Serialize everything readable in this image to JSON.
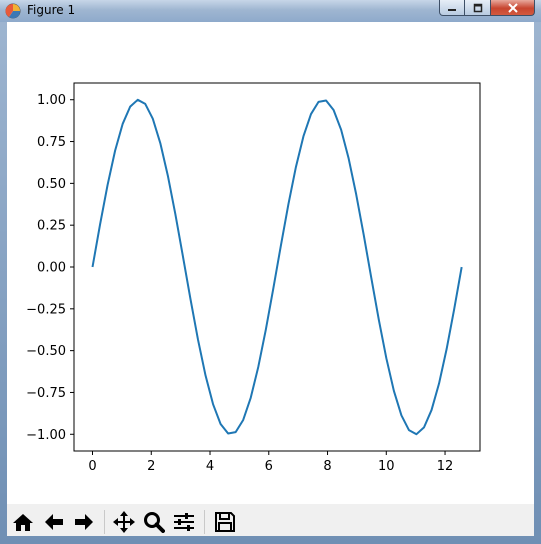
{
  "window": {
    "title": "Figure 1",
    "icons": [
      "app-icon",
      "minimize-icon",
      "maximize-icon",
      "close-icon"
    ]
  },
  "chart_data": {
    "type": "line",
    "title": "",
    "xlabel": "",
    "ylabel": "",
    "xlim": [
      -0.63,
      13.19
    ],
    "ylim": [
      -1.1,
      1.1
    ],
    "xticks": [
      0,
      2,
      4,
      6,
      8,
      10,
      12
    ],
    "xtick_labels": [
      "0",
      "2",
      "4",
      "6",
      "8",
      "10",
      "12"
    ],
    "yticks": [
      -1.0,
      -0.75,
      -0.5,
      -0.25,
      0.0,
      0.25,
      0.5,
      0.75,
      1.0
    ],
    "ytick_labels": [
      "−1.00",
      "−0.75",
      "−0.50",
      "−0.25",
      "0.00",
      "0.25",
      "0.50",
      "0.75",
      "1.00"
    ],
    "grid": false,
    "series": [
      {
        "color": "#1f77b4",
        "function": "sin",
        "x_start": 0,
        "x_end": 12.566,
        "n_points": 50
      }
    ]
  },
  "toolbar": {
    "buttons": [
      "home-icon",
      "back-icon",
      "forward-icon",
      "pan-icon",
      "zoom-icon",
      "configure-subplots-icon",
      "save-icon"
    ]
  }
}
